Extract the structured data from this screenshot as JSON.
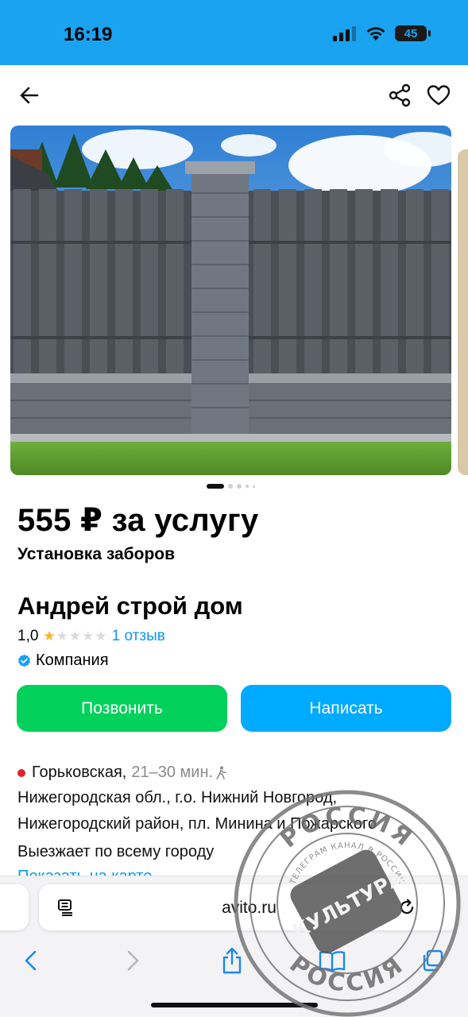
{
  "status_bar": {
    "time": "16:19",
    "battery": "45",
    "background": "#1aa3f0"
  },
  "nav": {
    "back_icon": "arrow-left-icon",
    "share_icon": "share-icon",
    "favorite_icon": "heart-outline-icon"
  },
  "gallery": {
    "photo_count": 5,
    "active_index": 0
  },
  "listing": {
    "price": "555 ₽ за услугу",
    "title": "Установка заборов"
  },
  "seller": {
    "name": "Андрей строй дом",
    "rating": "1,0",
    "stars_filled": 1,
    "stars_total": 5,
    "reviews": "1 отзыв",
    "type": "Компания"
  },
  "actions": {
    "call_label": "Позвонить",
    "write_label": "Написать",
    "call_color": "#02d15c",
    "write_color": "#00aaff"
  },
  "location": {
    "metro": "Горьковская,",
    "metro_time": "21–30 мин.",
    "metro_color": "#e0242a",
    "address_line1": "Нижегородская обл., г.о. Нижний Новгород,",
    "address_line2": "Нижегородский район, пл. Минина и Пожарского",
    "service_area": "Выезжает по всему городу",
    "map_link": "Показать на карте"
  },
  "browser": {
    "url": "avito.ru",
    "reader_icon": "reader-icon",
    "reload_icon": "reload-icon",
    "back_icon": "chevron-left-icon",
    "forward_icon": "chevron-right-icon",
    "share_icon": "share-icon",
    "bookmarks_icon": "book-icon",
    "tabs_icon": "tabs-icon"
  },
  "watermark": {
    "top_text": "РОССИЯ",
    "center_text": "КУЛЬТУРА",
    "bottom_text": "РОССИЯ",
    "ring_text": "ТЕЛЕГРАМ КАНАЛ В РОССИИ"
  }
}
